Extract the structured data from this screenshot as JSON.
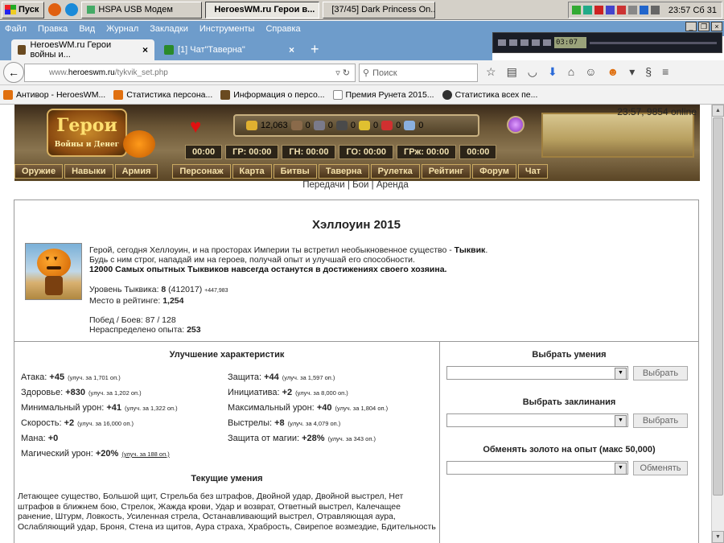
{
  "taskbar": {
    "start": "Пуск",
    "items": [
      {
        "label": "HSPA USB Модем",
        "active": false
      },
      {
        "label": "HeroesWM.ru Герои в...",
        "active": true
      },
      {
        "label": "[37/45] Dark Princess On...",
        "active": false
      }
    ],
    "clock": "23:57 Сб 31"
  },
  "menubar": {
    "items": [
      "Файл",
      "Правка",
      "Вид",
      "Журнал",
      "Закладки",
      "Инструменты",
      "Справка"
    ]
  },
  "media": {
    "time": "03:07"
  },
  "tabs": [
    {
      "label": "HeroesWM.ru Герои войны и...",
      "close": "×"
    },
    {
      "label": "[1] Чат\"Таверна\"",
      "close": "×"
    }
  ],
  "newtab": "+",
  "url": {
    "prefix": "www.",
    "domain": "heroeswm.ru",
    "path": "/tykvik_set.php"
  },
  "search": {
    "placeholder": "Поиск"
  },
  "bookmarks": [
    {
      "label": "Антивор - HeroesWM...",
      "color": "#e07010"
    },
    {
      "label": "Статистика персона...",
      "color": "#e07010"
    },
    {
      "label": "Информация о персо...",
      "color": "#6a4a20"
    },
    {
      "label": "Премия Рунета 2015...",
      "color": "#ffffff"
    },
    {
      "label": "Статистика всех пе...",
      "color": "#303030"
    }
  ],
  "game": {
    "server_time": "23:57, 9854 online",
    "logo": {
      "title": "Герои",
      "subtitle": "Войны и Денег"
    },
    "resources": [
      "12,063",
      "0",
      "0",
      "0",
      "0",
      "0",
      "0"
    ],
    "timers": [
      "00:00",
      "ГР: 00:00",
      "ГН: 00:00",
      "ГО: 00:00",
      "ГРж: 00:00",
      "00:00"
    ],
    "nav": [
      "Оружие",
      "Навыки",
      "Армия",
      "Персонаж",
      "Карта",
      "Битвы",
      "Таверна",
      "Рулетка",
      "Рейтинг",
      "Форум",
      "Чат"
    ],
    "sublinks": "Передачи | Бои | Аренда"
  },
  "intro": {
    "title": "Хэллоуин 2015",
    "line1a": "Герой, сегодня Хеллоуин, и на просторах Империи ты встретил необыкновенное существо - ",
    "line1b": "Тыквик",
    "line1c": ".",
    "line2": "Будь с ним строг, нападай им на героев, получай опыт и улучшай его способности.",
    "line3": "12000 Самых опытных Тыквиков навсегда останутся в достижениях своего хозяина.",
    "level_label": "Уровень Тыквика:",
    "level": "8",
    "level_exp": "(412017)",
    "level_gain": "+447,983",
    "rank_label": "Место в рейтинге:",
    "rank": "1,254",
    "wins_label": "Побед / Боев: 87 / 128",
    "unspent_label": "Нераспределено опыта:",
    "unspent": "253"
  },
  "upgrades": {
    "title": "Улучшение характеристик",
    "left": [
      {
        "label": "Атака:",
        "value": "+45",
        "cost": "(улуч. за 1,701 оп.)"
      },
      {
        "label": "Здоровье:",
        "value": "+830",
        "cost": "(улуч. за 1,202 оп.)"
      },
      {
        "label": "Минимальный урон:",
        "value": "+41",
        "cost": "(улуч. за 1,322 оп.)"
      },
      {
        "label": "Скорость:",
        "value": "+2",
        "cost": "(улуч. за 16,000 оп.)"
      },
      {
        "label": "Мана:",
        "value": "+0",
        "cost": ""
      },
      {
        "label": "Магический урон:",
        "value": "+20%",
        "cost": "(улуч. за 188 оп.)"
      }
    ],
    "right": [
      {
        "label": "Защита:",
        "value": "+44",
        "cost": "(улуч. за 1,597 оп.)"
      },
      {
        "label": "Инициатива:",
        "value": "+2",
        "cost": "(улуч. за 8,000 оп.)"
      },
      {
        "label": "Максимальный урон:",
        "value": "+40",
        "cost": "(улуч. за 1,804 оп.)"
      },
      {
        "label": "Выстрелы:",
        "value": "+8",
        "cost": "(улуч. за 4,079 оп.)"
      },
      {
        "label": "Защита от магии:",
        "value": "+28%",
        "cost": "(улуч. за 343 оп.)"
      }
    ]
  },
  "current_skills": {
    "title": "Текущие умения",
    "text": "Летающее существо, Большой щит, Стрельба без штрафов, Двойной удар, Двойной выстрел, Нет штрафов в ближнем бою, Стрелок, Жажда крови, Удар и возврат, Ответный выстрел, Калечащее ранение, Штурм, Ловкость, Усиленная стрела, Останавливающий выстрел, Отравляющая аура, Ослабляющий удар, Броня, Стена из щитов, Аура страха, Храбрость, Свирепое возмездие, Бдительность"
  },
  "choose": {
    "skills_title": "Выбрать умения",
    "skills_btn": "Выбрать",
    "spells_title": "Выбрать заклинания",
    "spells_btn": "Выбрать",
    "exchange_title": "Обменять золото на опыт (макс 50,000)",
    "exchange_btn": "Обменять"
  }
}
